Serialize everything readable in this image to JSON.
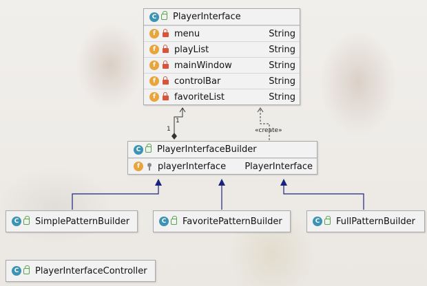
{
  "diagram": {
    "classes": {
      "player_interface": {
        "name": "PlayerInterface",
        "fields": [
          {
            "name": "menu",
            "type": "String"
          },
          {
            "name": "playList",
            "type": "String"
          },
          {
            "name": "mainWindow",
            "type": "String"
          },
          {
            "name": "controlBar",
            "type": "String"
          },
          {
            "name": "favoriteList",
            "type": "String"
          }
        ]
      },
      "builder": {
        "name": "PlayerInterfaceBuilder",
        "fields": [
          {
            "name": "playerInterface",
            "type": "PlayerInterface"
          }
        ]
      },
      "simple": {
        "name": "SimplePatternBuilder"
      },
      "favorite": {
        "name": "FavoritePatternBuilder"
      },
      "full": {
        "name": "FullPatternBuilder"
      },
      "controller": {
        "name": "PlayerInterfaceController"
      }
    },
    "relations": {
      "multiplicity_upper": "1",
      "multiplicity_lower": "1",
      "create_label": "«create»"
    },
    "icons": {
      "class_letter": "C",
      "field_letter": "f"
    }
  }
}
